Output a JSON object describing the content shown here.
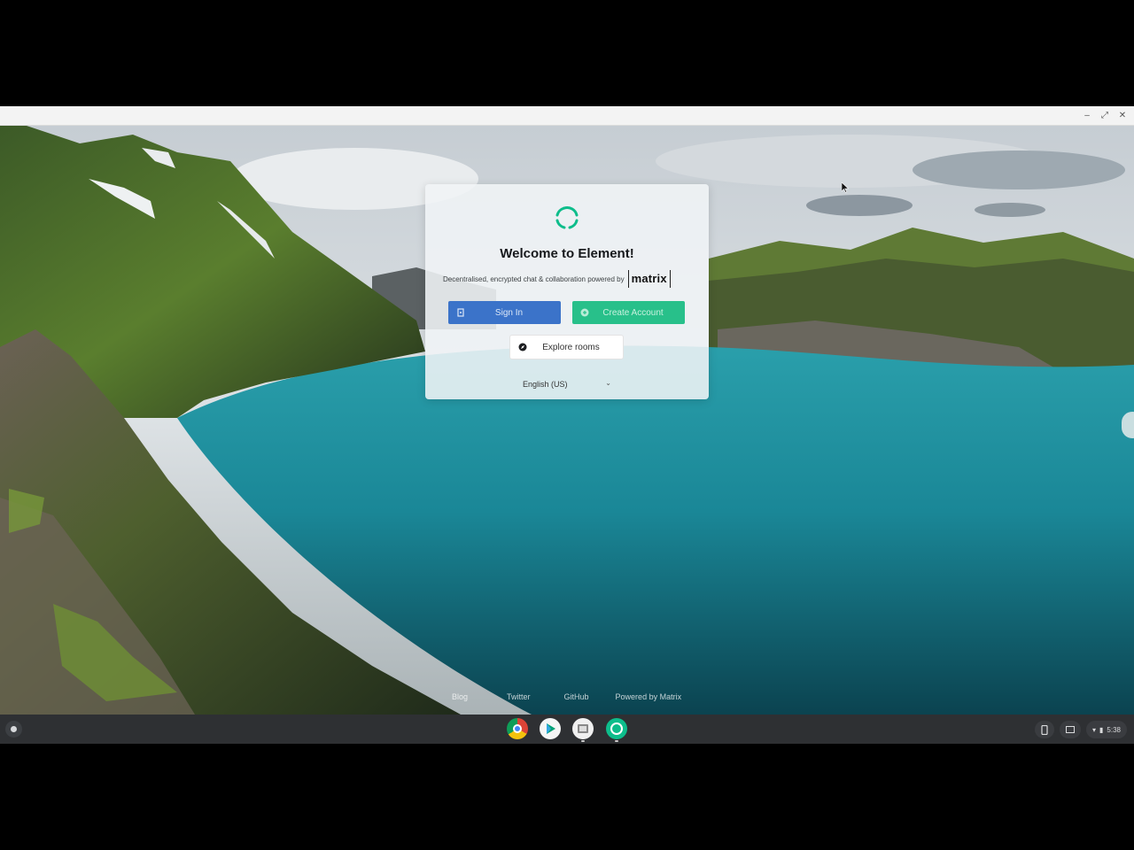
{
  "window": {
    "controls": {
      "minimize": "–",
      "maximize": "⤢",
      "close": "✕"
    }
  },
  "card": {
    "title": "Welcome to Element!",
    "tagline": "Decentralised, encrypted chat & collaboration powered by",
    "matrix_logo": "matrix",
    "signin_label": "Sign In",
    "create_label": "Create Account",
    "explore_label": "Explore rooms",
    "language": "English (US)"
  },
  "footer": {
    "links": [
      "Blog",
      "Twitter",
      "GitHub",
      "Powered by Matrix"
    ]
  },
  "shelf": {
    "apps": [
      {
        "name": "chrome-icon"
      },
      {
        "name": "play-store-icon"
      },
      {
        "name": "files-icon"
      },
      {
        "name": "element-icon"
      }
    ],
    "clock": "5:38"
  },
  "colors": {
    "signin": "#3b73c9",
    "create": "#28c08a",
    "element_green": "#0dbd8b",
    "shelf": "#2e3033"
  }
}
